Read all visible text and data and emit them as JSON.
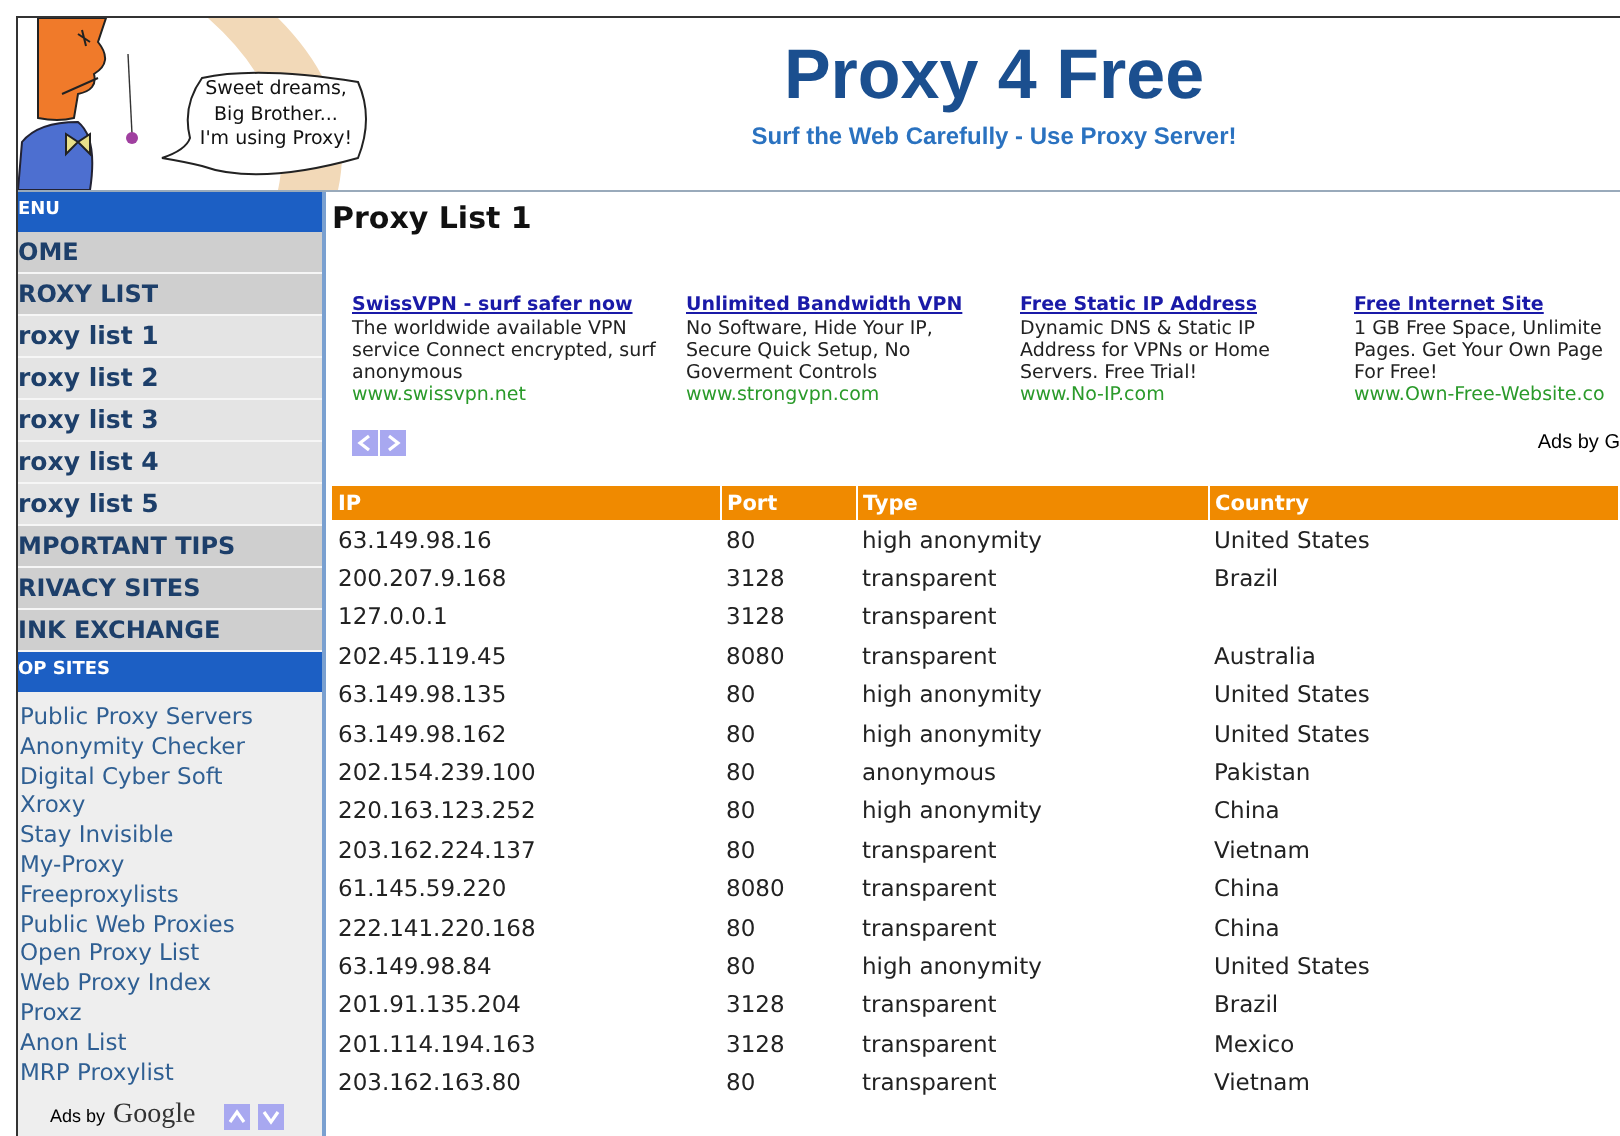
{
  "header": {
    "speech_bubble": [
      "Sweet dreams,",
      "Big Brother...",
      "I'm using Proxy!"
    ],
    "title": "Proxy 4 Free",
    "subtitle": "Surf the Web Carefully - Use Proxy Server!"
  },
  "sidebar": {
    "items": [
      {
        "kind": "header",
        "label": "ENU"
      },
      {
        "kind": "section",
        "label": "OME"
      },
      {
        "kind": "section",
        "label": "ROXY LIST"
      },
      {
        "kind": "sub",
        "label": "roxy list 1"
      },
      {
        "kind": "sub",
        "label": "roxy list 2"
      },
      {
        "kind": "sub",
        "label": "roxy list 3"
      },
      {
        "kind": "sub",
        "label": "roxy list 4"
      },
      {
        "kind": "sub",
        "label": "roxy list 5"
      },
      {
        "kind": "section",
        "label": "MPORTANT TIPS"
      },
      {
        "kind": "section",
        "label": "RIVACY SITES"
      },
      {
        "kind": "section",
        "label": "INK EXCHANGE"
      },
      {
        "kind": "header",
        "label": "OP SITES"
      }
    ],
    "links": [
      "Public Proxy Servers",
      "Anonymity Checker",
      "Digital Cyber Soft",
      "Xroxy",
      "Stay Invisible",
      "My-Proxy",
      "Freeproxylists",
      "Public Web Proxies",
      "Open Proxy List",
      "Web Proxy Index",
      "Proxz",
      "Anon List",
      "MRP Proxylist"
    ],
    "ads_label": "Ads by",
    "ads_brand": "Google"
  },
  "main": {
    "heading": "Proxy List 1",
    "ads": [
      {
        "title": "SwissVPN - surf safer now",
        "lines": [
          "The worldwide available VPN",
          "service Connect encrypted, surf",
          "anonymous"
        ],
        "url": "www.swissvpn.net"
      },
      {
        "title": "Unlimited Bandwidth VPN",
        "lines": [
          "No Software, Hide Your IP,",
          "Secure Quick Setup, No",
          "Goverment Controls"
        ],
        "url": "www.strongvpn.com"
      },
      {
        "title": "Free Static IP Address",
        "lines": [
          "Dynamic DNS & Static IP",
          "Address for VPNs or Home",
          "Servers. Free Trial!"
        ],
        "url": "www.No-IP.com"
      },
      {
        "title": "Free Internet Site",
        "lines": [
          "1 GB Free Space, Unlimite",
          "Pages. Get Your Own Page",
          "For Free!"
        ],
        "url": "www.Own-Free-Website.co"
      }
    ],
    "ads_label": "Ads by G",
    "table": {
      "columns": [
        "IP",
        "Port",
        "Type",
        "Country"
      ],
      "rows": [
        [
          "63.149.98.16",
          "80",
          "high anonymity",
          "United States"
        ],
        [
          "200.207.9.168",
          "3128",
          "transparent",
          "Brazil"
        ],
        [
          "127.0.0.1",
          "3128",
          "transparent",
          ""
        ],
        [
          "202.45.119.45",
          "8080",
          "transparent",
          "Australia"
        ],
        [
          "63.149.98.135",
          "80",
          "high anonymity",
          "United States"
        ],
        [
          "63.149.98.162",
          "80",
          "high anonymity",
          "United States"
        ],
        [
          "202.154.239.100",
          "80",
          "anonymous",
          "Pakistan"
        ],
        [
          "220.163.123.252",
          "80",
          "high anonymity",
          "China"
        ],
        [
          "203.162.224.137",
          "80",
          "transparent",
          "Vietnam"
        ],
        [
          "61.145.59.220",
          "8080",
          "transparent",
          "China"
        ],
        [
          "222.141.220.168",
          "80",
          "transparent",
          "China"
        ],
        [
          "63.149.98.84",
          "80",
          "high anonymity",
          "United States"
        ],
        [
          "201.91.135.204",
          "3128",
          "transparent",
          "Brazil"
        ],
        [
          "201.114.194.163",
          "3128",
          "transparent",
          "Mexico"
        ],
        [
          "203.162.163.80",
          "80",
          "transparent",
          "Vietnam"
        ]
      ]
    }
  }
}
